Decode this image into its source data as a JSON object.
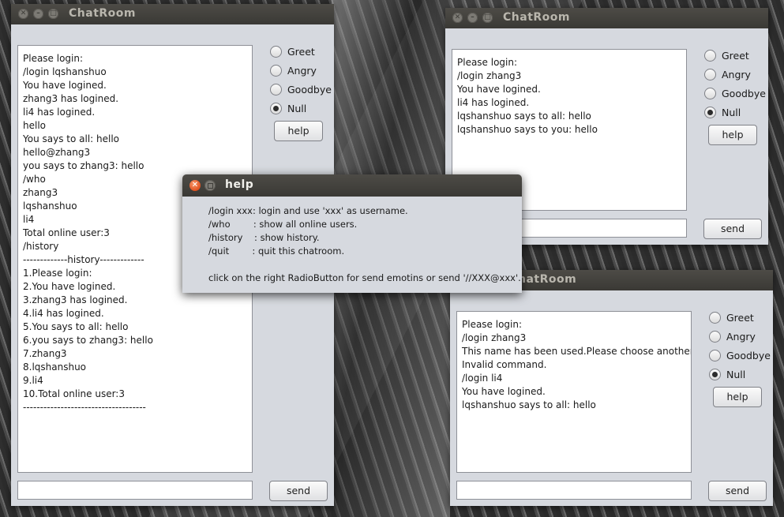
{
  "windows": [
    {
      "title": "ChatRoom",
      "log": [
        "Please login:",
        "/login lqshanshuo",
        "You have logined.",
        "zhang3 has logined.",
        "li4 has logined.",
        "hello",
        "You says to all: hello",
        "hello@zhang3",
        "you says to zhang3: hello",
        "/who",
        "zhang3",
        "lqshanshuo",
        "li4",
        "Total online user:3",
        "/history",
        "-------------history-------------",
        "1.Please login:",
        "2.You have logined.",
        "3.zhang3 has logined.",
        "4.li4 has logined.",
        "5.You says to all: hello",
        "6.you says to zhang3: hello",
        "7.zhang3",
        "8.lqshanshuo",
        "9.li4",
        "10.Total online user:3",
        "------------------------------------"
      ],
      "radios": [
        "Greet",
        "Angry",
        "Goodbye",
        "Null"
      ],
      "selected_radio": "Null",
      "help_label": "help",
      "send_label": "send",
      "input_value": ""
    },
    {
      "title": "ChatRoom",
      "log": [
        "Please login:",
        "/login zhang3",
        "You have logined.",
        "li4 has logined.",
        "lqshanshuo says to all: hello",
        "lqshanshuo says to you: hello"
      ],
      "radios": [
        "Greet",
        "Angry",
        "Goodbye",
        "Null"
      ],
      "selected_radio": "Null",
      "help_label": "help",
      "send_label": "send",
      "input_value": ""
    },
    {
      "title": "ChatRoom",
      "visible_title": "hatRoom",
      "log": [
        "Please login:",
        "/login zhang3",
        "This name has been used.Please choose another.",
        "Invalid command.",
        "/login li4",
        "You have logined.",
        "lqshanshuo says to all: hello"
      ],
      "radios": [
        "Greet",
        "Angry",
        "Goodbye",
        "Null"
      ],
      "selected_radio": "Null",
      "help_label": "help",
      "send_label": "send",
      "input_value": ""
    }
  ],
  "help_dialog": {
    "title": "help",
    "lines": [
      "/login xxx: login and use 'xxx' as username.",
      "/who        : show all online users.",
      "/history    : show history.",
      "/quit        : quit this chatroom.",
      "",
      "click on the right RadioButton for send emotins or send '//XXX@xxx'."
    ]
  },
  "titlebar_buttons": {
    "close": "✕",
    "minimize": "–",
    "maximize": "□"
  }
}
